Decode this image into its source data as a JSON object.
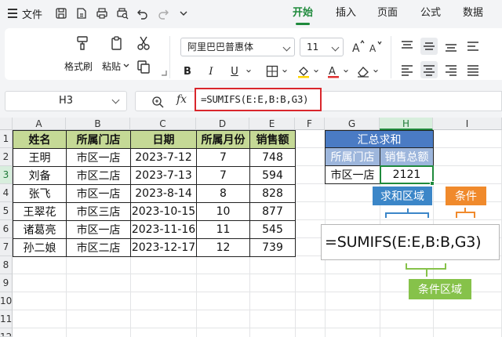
{
  "menu": {
    "file_label": "文件",
    "tabs": [
      "开始",
      "插入",
      "页面",
      "公式",
      "数据"
    ],
    "active_tab": "开始"
  },
  "ribbon": {
    "format_painter_label": "格式刷",
    "paste_label": "粘贴",
    "font_name": "阿里巴巴普惠体",
    "font_size": "11"
  },
  "formula_bar": {
    "cell_ref": "H3",
    "fx_label": "fx",
    "formula": "=SUMIFS(E:E,B:B,G3)"
  },
  "grid": {
    "columns": [
      "A",
      "B",
      "C",
      "D",
      "E",
      "F",
      "G",
      "H",
      "I"
    ],
    "active_column": "H",
    "rows": [
      "1",
      "2",
      "3",
      "4",
      "5",
      "6",
      "7",
      "8",
      "9",
      "10",
      "11",
      "12"
    ],
    "active_row": "3"
  },
  "table": {
    "headers": [
      "姓名",
      "所属门店",
      "日期",
      "所属月份",
      "销售额"
    ],
    "rows": [
      [
        "王明",
        "市区一店",
        "2023-7-12",
        "7",
        "748"
      ],
      [
        "刘备",
        "市区二店",
        "2023-7-13",
        "7",
        "594"
      ],
      [
        "张飞",
        "市区一店",
        "2023-8-14",
        "8",
        "828"
      ],
      [
        "王翠花",
        "市区三店",
        "2023-10-15",
        "10",
        "877"
      ],
      [
        "诸葛亮",
        "市区一店",
        "2023-11-16",
        "11",
        "545"
      ],
      [
        "孙二娘",
        "市区二店",
        "2023-12-17",
        "12",
        "739"
      ]
    ]
  },
  "summary": {
    "title": "汇总求和",
    "col_store": "所属门店",
    "col_sales": "销售总额",
    "store": "市区一店",
    "total": "2121"
  },
  "annotations": {
    "sum_range": "求和区域",
    "criteria": "条件",
    "criteria_range": "条件区域",
    "big_formula": "=SUMIFS(E:E,B:B,G3)"
  },
  "colors": {
    "accent": "#1f8a3c",
    "header_fill": "#c5d996",
    "summary_title": "#4a7bc4",
    "summary_sub": "#9db6dc",
    "formula_highlight": "#d9262c",
    "tag_blue": "#3b86c8",
    "tag_orange": "#f08a2c",
    "tag_green": "#86c24a"
  }
}
